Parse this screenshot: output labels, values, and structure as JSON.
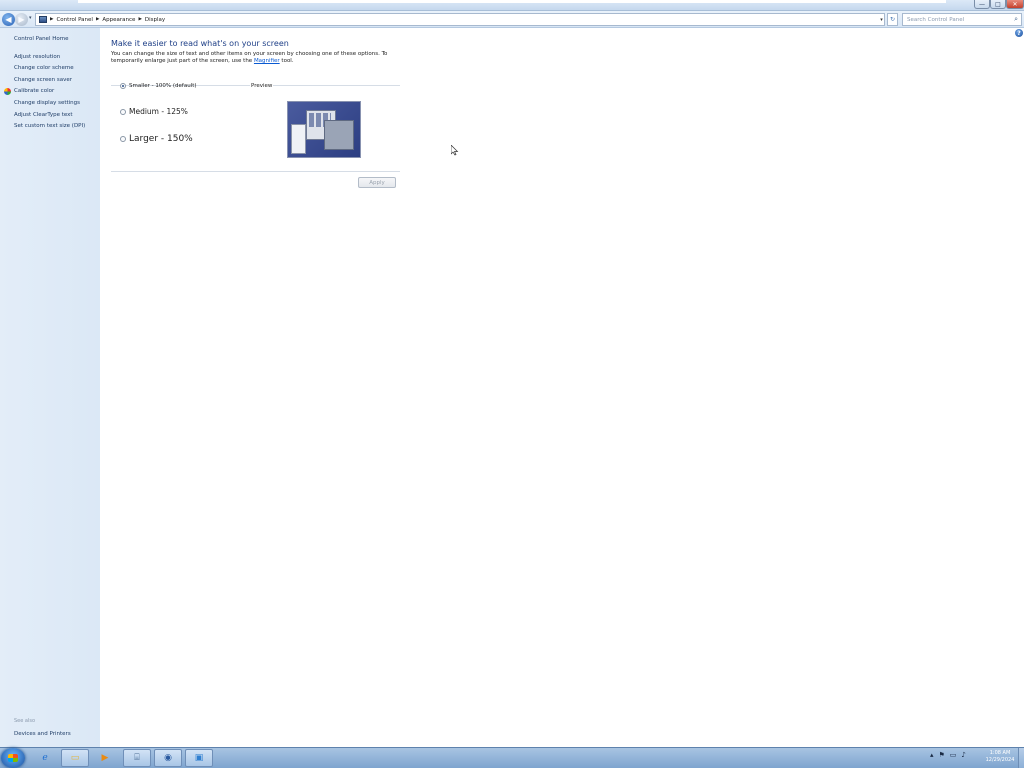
{
  "window": {
    "minimize_glyph": "—",
    "maximize_glyph": "□",
    "close_glyph": "✕"
  },
  "address": {
    "breadcrumb": [
      "Control Panel",
      "Appearance",
      "Display"
    ],
    "recent_glyph": "▾",
    "dropdown_glyph": "▾",
    "refresh_glyph": "↻",
    "search_placeholder": "Search Control Panel",
    "search_icon_glyph": "⌕"
  },
  "sidebar": {
    "home": "Control Panel Home",
    "items": [
      "Adjust resolution",
      "Change color scheme",
      "Change screen saver",
      "Calibrate color",
      "Change display settings",
      "Adjust ClearType text",
      "Set custom text size (DPI)"
    ],
    "see_also_heading": "See also",
    "see_also_items": [
      "Devices and Printers"
    ]
  },
  "help_glyph": "?",
  "main": {
    "heading": "Make it easier to read what's on your screen",
    "desc_line1": "You can change the size of text and other items on your screen by choosing one of these options. To",
    "desc_line2_pre": "temporarily enlarge just part of the screen, use the ",
    "desc_link": "Magnifier",
    "desc_line2_post": " tool.",
    "options": [
      {
        "label": "Smaller - 100% (default)",
        "selected": true
      },
      {
        "label": "Medium - 125%",
        "selected": false
      },
      {
        "label": "Larger - 150%",
        "selected": false
      }
    ],
    "preview_label": "Preview",
    "apply_label": "Apply"
  },
  "taskbar": {
    "items": [
      {
        "icon": "internet-explorer-icon",
        "glyph": "ℯ",
        "color": "#1f6fd1",
        "active": false
      },
      {
        "icon": "windows-explorer-icon",
        "glyph": "▭",
        "color": "#e5b53a",
        "active": true
      },
      {
        "icon": "media-player-icon",
        "glyph": "▶",
        "color": "#e88a12",
        "active": false
      },
      {
        "icon": "network-icon",
        "glyph": "⌸",
        "color": "#4a6b92",
        "active": false
      },
      {
        "icon": "eye-icon",
        "glyph": "◉",
        "color": "#2a5aa0",
        "active": false
      },
      {
        "icon": "monitor-icon",
        "glyph": "▣",
        "color": "#2f7fd0",
        "active": false
      }
    ],
    "tray_glyphs": [
      "▴",
      "⚑",
      "▭",
      "♪"
    ],
    "clock_time": "1:08 AM",
    "clock_date": "12/29/2024"
  }
}
